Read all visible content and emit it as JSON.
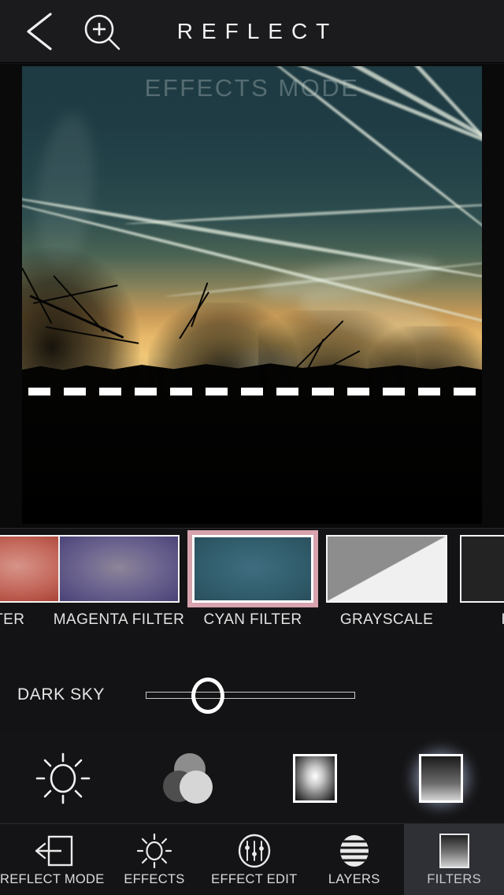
{
  "app": {
    "title": "REFLECT",
    "background": "#141416"
  },
  "topbar": {
    "back_icon": "back-chevron-icon",
    "zoom_icon": "zoom-in-magnifier-icon",
    "brand": "REFLECT"
  },
  "canvas": {
    "mode_overlay": "EFFECTS MODE",
    "split_line": "dashed-reflect-line",
    "photo_description": "sunset-sky-with-contrails"
  },
  "filters": {
    "selected": "CYAN FILTER",
    "selected_border_color": "#d7a3ae",
    "items": [
      {
        "label": "RED FILTER",
        "visible_label": "LTER",
        "swatch": "sw-red",
        "selected": false
      },
      {
        "label": "MAGENTA FILTER",
        "visible_label": "MAGENTA FILTER",
        "swatch": "sw-mag",
        "selected": false
      },
      {
        "label": "CYAN FILTER",
        "visible_label": "CYAN FILTER",
        "swatch": "sw-cyan",
        "selected": true
      },
      {
        "label": "GRAYSCALE",
        "visible_label": "GRAYSCALE",
        "swatch": "sw-gray",
        "selected": false
      },
      {
        "label": "HIGH CONTRAST",
        "visible_label": "HIGH",
        "swatch": "sw-high",
        "selected": false
      }
    ]
  },
  "slider": {
    "label": "DARK SKY",
    "value_percent": 22,
    "min": 0,
    "max": 100
  },
  "effects": {
    "items": [
      {
        "name": "brightness-sun-icon",
        "selected": false
      },
      {
        "name": "color-balance-circles-icon",
        "selected": false
      },
      {
        "name": "vignette-icon",
        "selected": false
      },
      {
        "name": "gradient-filter-icon",
        "selected": true
      }
    ]
  },
  "navbar": {
    "active": "FILTERS",
    "active_bg": "#2e3036",
    "items": [
      {
        "label": "REFLECT MODE",
        "icon": "exit-arrow-square-icon",
        "active": false
      },
      {
        "label": "EFFECTS",
        "icon": "brightness-sun-icon",
        "active": false
      },
      {
        "label": "EFFECT EDIT",
        "icon": "sliders-circle-icon",
        "active": false
      },
      {
        "label": "LAYERS",
        "icon": "striped-circle-icon",
        "active": false
      },
      {
        "label": "FILTERS",
        "icon": "gradient-square-icon",
        "active": true
      }
    ]
  }
}
